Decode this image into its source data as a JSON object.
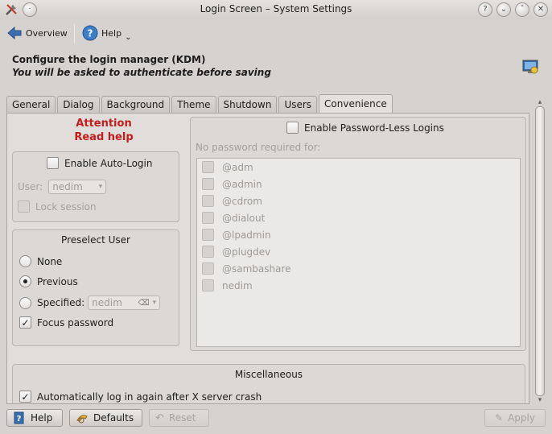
{
  "window": {
    "title": "Login Screen – System Settings",
    "title_buttons": [
      "?",
      "⌄",
      "ˆ",
      "✕"
    ]
  },
  "toolbar": {
    "overview_label": "Overview",
    "help_label": "Help"
  },
  "header": {
    "title": "Configure the login manager (KDM)",
    "subtitle": "You will be asked to authenticate before saving"
  },
  "tabs": [
    {
      "label": "General",
      "active": false
    },
    {
      "label": "Dialog",
      "active": false
    },
    {
      "label": "Background",
      "active": false
    },
    {
      "label": "Theme",
      "active": false
    },
    {
      "label": "Shutdown",
      "active": false
    },
    {
      "label": "Users",
      "active": false
    },
    {
      "label": "Convenience",
      "active": true
    }
  ],
  "attention": {
    "line1": "Attention",
    "line2": "Read help"
  },
  "auto_login": {
    "checkbox_label": "Enable Auto-Login",
    "checked": false,
    "user_label": "User:",
    "user_value": "nedim",
    "lock_label": "Lock session"
  },
  "preselect": {
    "title": "Preselect User",
    "none_label": "None",
    "previous_label": "Previous",
    "specified_label": "Specified:",
    "specified_value": "nedim",
    "selected": "Previous",
    "focus_label": "Focus password",
    "focus_checked": true
  },
  "passwordless": {
    "checkbox_label": "Enable Password-Less Logins",
    "checked": false,
    "list_label": "No password required for:",
    "items": [
      "@adm",
      "@admin",
      "@cdrom",
      "@dialout",
      "@lpadmin",
      "@plugdev",
      "@sambashare",
      "nedim"
    ]
  },
  "misc": {
    "title": "Miscellaneous",
    "autorelogin_label": "Automatically log in again after X server crash",
    "autorelogin_checked": true
  },
  "bottom": {
    "help_label": "Help",
    "defaults_label": "Defaults",
    "reset_label": "Reset",
    "apply_label": "Apply"
  },
  "colors": {
    "attention": "#c21c1c",
    "accent": "#3d7ec8"
  }
}
